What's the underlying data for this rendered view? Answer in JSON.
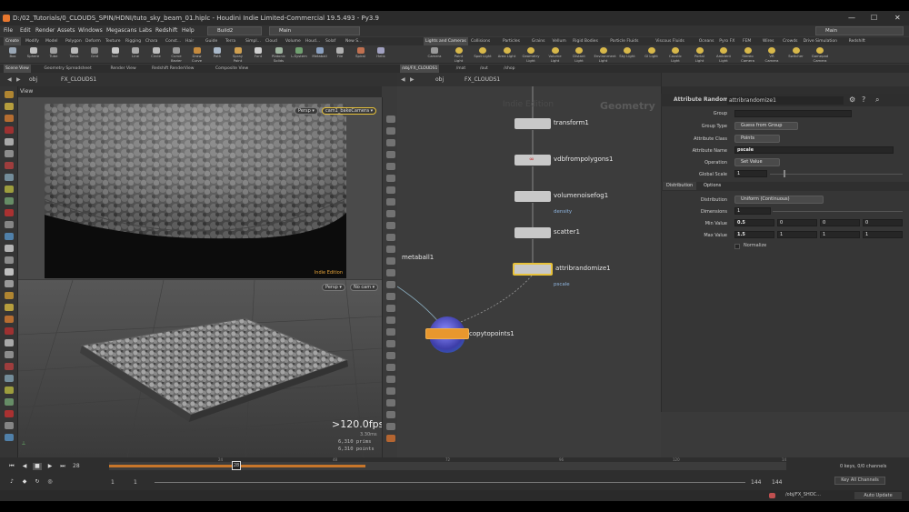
{
  "window": {
    "title": "D:/02_Tutorials/0_CLOUDS_SPIN/HDNI/tuto_sky_beam_01.hiplc - Houdini Indie Limited-Commercial 19.5.493 - Py3.9",
    "minimize": "—",
    "maximize": "☐",
    "close": "✕"
  },
  "menu": {
    "items": [
      "File",
      "Edit",
      "Render",
      "Assets",
      "Windows",
      "Megascans",
      "Labs",
      "Redshift",
      "Help"
    ],
    "build": "Build2",
    "main_desktop": "Main",
    "right_desktop": "Main"
  },
  "shelf_tabs_left": [
    "Create",
    "Modify",
    "Model",
    "Polygon",
    "Deform",
    "Texture",
    "Rigging",
    "Chara",
    "Const...",
    "Hair",
    "Guide",
    "Terra",
    "Simpl...",
    "Cloud",
    "Volume",
    "Houd...",
    "Solaf",
    "New S..."
  ],
  "shelf_tabs_right": [
    "Lights and Cameras",
    "Collisions",
    "Particles",
    "Grains",
    "Vellum",
    "Rigid Bodies",
    "Particle Fluids",
    "Viscous Fluids",
    "Oceans",
    "Pyro FX",
    "FEM",
    "Wires",
    "Crowds",
    "Drive Simulation",
    "Redshift"
  ],
  "tools_left": [
    "Box",
    "Sphere",
    "Tube",
    "Torus",
    "Grid",
    "Null",
    "Line",
    "Circle",
    "Curve Bezier",
    "Draw Curve",
    "Path",
    "Spray Paint",
    "Font",
    "Platonic Solids",
    "L-System",
    "Metaball",
    "File",
    "Spiral",
    "Helix"
  ],
  "tools_right": [
    "Camera",
    "Point Light",
    "Spot Light",
    "Area Light",
    "Geometry Light",
    "Volume Light",
    "Distant Light",
    "Environment Light",
    "Sky Light",
    "GI Light",
    "Caustic Light",
    "Portal Light",
    "Ambient Light",
    "Stereo Camera",
    "VR Camera",
    "Switcher",
    "Gamepad Camera"
  ],
  "pane_tabs_left": [
    "Scene View",
    "Geometry Spreadsheet",
    "Render View",
    "Redshift RenderView",
    "Composite View"
  ],
  "pane_tabs_right": [
    "/obj/FX_CLOUDS1",
    "/mat",
    "/out",
    "/shop"
  ],
  "viewport": {
    "path_obj": "obj",
    "path_node": "FX_CLOUDS1",
    "view_label": "View",
    "persp": "Persp ▾",
    "camera": "cam1_bakeCamera ▾",
    "persp2": "Persp ▾",
    "nocam": "No cam ▾",
    "watermark": "Indie Edition",
    "fps": ">120.0fps",
    "ms": "3.30ms",
    "prims": "6,310  prims",
    "points": "6,310  points"
  },
  "network": {
    "path_obj": "obj",
    "path_node": "FX_CLOUDS1",
    "context": "Geometry",
    "watermark": "Indie Edition",
    "nodes": [
      {
        "name": "transform1",
        "sub": ""
      },
      {
        "name": "vdbfrompolygons1",
        "sub": ""
      },
      {
        "name": "volumenoisefog1",
        "sub": "density"
      },
      {
        "name": "scatter1",
        "sub": ""
      },
      {
        "name": "attribrandomize1",
        "sub": "pscale"
      },
      {
        "name": "metaball1",
        "sub": ""
      },
      {
        "name": "copytopoints1",
        "sub": ""
      }
    ]
  },
  "params": {
    "node_type": "Attribute Randomize",
    "node_name": "attribrandomize1",
    "group_label": "Group",
    "group_value": "",
    "group_type_label": "Group Type",
    "group_type_value": "Guess from Group",
    "attr_class_label": "Attribute Class",
    "attr_class_value": "Points",
    "attr_name_label": "Attribute Name",
    "attr_name_value": "pscale",
    "operation_label": "Operation",
    "operation_value": "Set Value",
    "global_scale_label": "Global Scale",
    "global_scale_value": "1",
    "tab_distribution": "Distribution",
    "tab_options": "Options",
    "distribution_label": "Distribution",
    "distribution_value": "Uniform (Continuous)",
    "dimensions_label": "Dimensions",
    "dimensions_value": "1",
    "min_label": "Min Value",
    "min_values": [
      "0.5",
      "0",
      "0",
      "0"
    ],
    "max_label": "Max Value",
    "max_values": [
      "1.5",
      "1",
      "1",
      "1"
    ],
    "normalize_label": "Normalize"
  },
  "timeline": {
    "current_frame": "28",
    "marker": "28",
    "ticks": [
      "24",
      "48",
      "72",
      "96",
      "120",
      "14"
    ],
    "start": "1",
    "start2": "1",
    "end": "144",
    "end2": "144",
    "keys": "0 keys, 0/0 channels",
    "key_all": "Key All Channels",
    "auto_update": "Auto Update",
    "status_path": "/obj/FX_SHOC..."
  },
  "colors": {
    "accent_orange": "#e8772e",
    "timeline_range": "#c8762a",
    "node_selected": "#e8c23a"
  }
}
